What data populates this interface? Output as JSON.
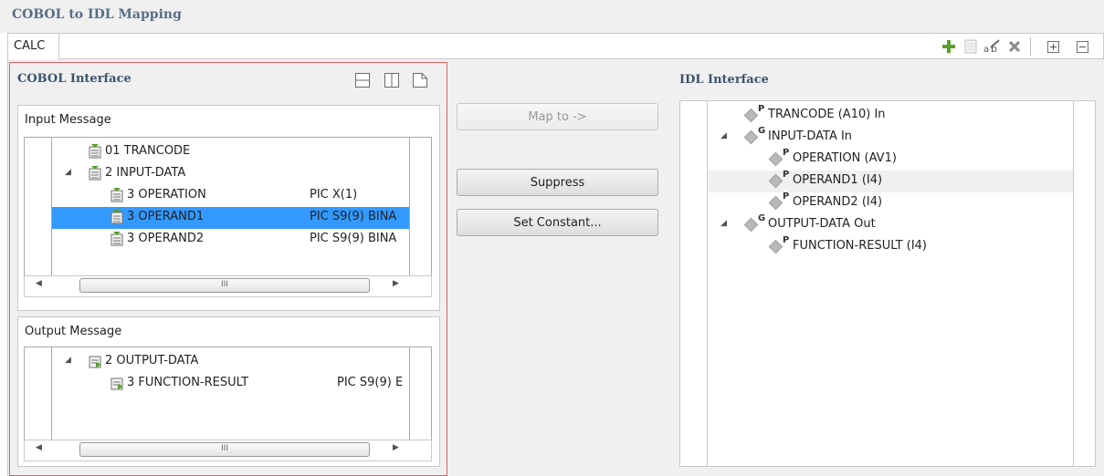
{
  "app": {
    "title": "COBOL to IDL Mapping"
  },
  "tab": {
    "label": "CALC"
  },
  "toolbar": {
    "icons": [
      "add-icon",
      "copy-icon",
      "rename-icon",
      "delete-icon",
      "expand-all-icon",
      "collapse-all-icon"
    ],
    "accent_green": "#5aa02c",
    "delete_gray": "#8a8a8a"
  },
  "cobol": {
    "title": "COBOL Interface",
    "input": {
      "label": "Input Message",
      "rows": [
        {
          "name": "01 TRANCODE",
          "pic": "",
          "expanded": null
        },
        {
          "name": "2 INPUT-DATA",
          "pic": "",
          "expanded": true
        },
        {
          "name": "3 OPERATION",
          "pic": "PIC X(1)",
          "expanded": null
        },
        {
          "name": "3 OPERAND1",
          "pic": "PIC S9(9) BINA",
          "expanded": null,
          "selected": true
        },
        {
          "name": "3 OPERAND2",
          "pic": "PIC S9(9) BINA",
          "expanded": null
        }
      ],
      "scroll_thumb": "III"
    },
    "output": {
      "label": "Output Message",
      "rows": [
        {
          "name": "2 OUTPUT-DATA",
          "pic": "",
          "expanded": true
        },
        {
          "name": "3 FUNCTION-RESULT",
          "pic": "PIC S9(9) E",
          "expanded": null
        }
      ],
      "scroll_thumb": "III"
    }
  },
  "actions": {
    "map_to": "Map to ->",
    "suppress": "Suppress",
    "set_constant": "Set Constant..."
  },
  "idl": {
    "title": "IDL Interface",
    "rows": [
      {
        "type": "P",
        "label": "TRANCODE  (A10)  In"
      },
      {
        "type": "G",
        "label": "INPUT-DATA  In",
        "expanded": true
      },
      {
        "type": "P",
        "label": "OPERATION  (AV1)"
      },
      {
        "type": "P",
        "label": "OPERAND1  (I4)",
        "highlighted": true
      },
      {
        "type": "P",
        "label": "OPERAND2  (I4)"
      },
      {
        "type": "G",
        "label": "OUTPUT-DATA  Out",
        "expanded": true
      },
      {
        "type": "P",
        "label": "FUNCTION-RESULT  (I4)"
      }
    ]
  },
  "colors": {
    "selection": "#3399ff",
    "hover_row": "#f0f0f0",
    "title_blue": "#3b526e",
    "frame_red": "#e06060"
  }
}
